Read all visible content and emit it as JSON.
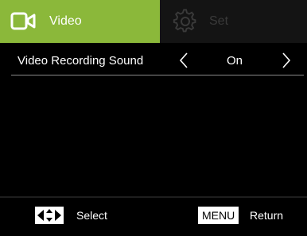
{
  "tabs": {
    "video": {
      "label": "Video",
      "icon": "video-camera-icon",
      "active": true
    },
    "set": {
      "label": "Set",
      "icon": "gear-icon",
      "active": false
    }
  },
  "menu": {
    "items": [
      {
        "label": "Video Recording Sound",
        "value": "On"
      }
    ]
  },
  "footer": {
    "select_icon": "four-way-arrows-icon",
    "select_label": "Select",
    "menu_key": "MENU",
    "return_label": "Return"
  },
  "colors": {
    "accent": "#8bb83a",
    "inactive_tab": "#141414",
    "background": "#000000",
    "text": "#ffffff"
  }
}
